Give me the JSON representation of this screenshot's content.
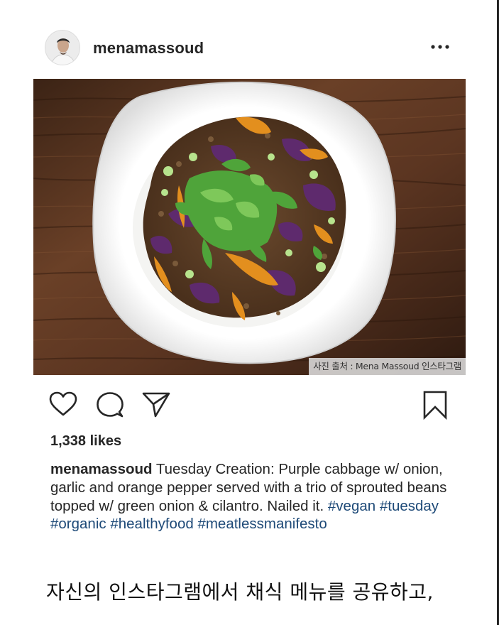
{
  "post": {
    "username": "menamassoud",
    "likes": "1,338 likes",
    "photo_credit": "사진 출처 : Mena Massoud 인스타그램",
    "caption_text": "Tuesday Creation: Purple cabbage w/ onion, garlic and orange pepper served with a trio of sprouted beans topped w/ green onion & cilantro. Nailed it.",
    "hashtags": [
      "#vegan",
      "#tuesday",
      "#organic",
      "#healthyfood",
      "#meatlessmanifesto"
    ],
    "icons": {
      "more": "more-options-icon",
      "like": "heart-icon",
      "comment": "comment-icon",
      "share": "paper-plane-icon",
      "save": "bookmark-icon"
    }
  },
  "article": {
    "korean_caption": "자신의 인스타그램에서 채식 메뉴를 공유하고,"
  }
}
